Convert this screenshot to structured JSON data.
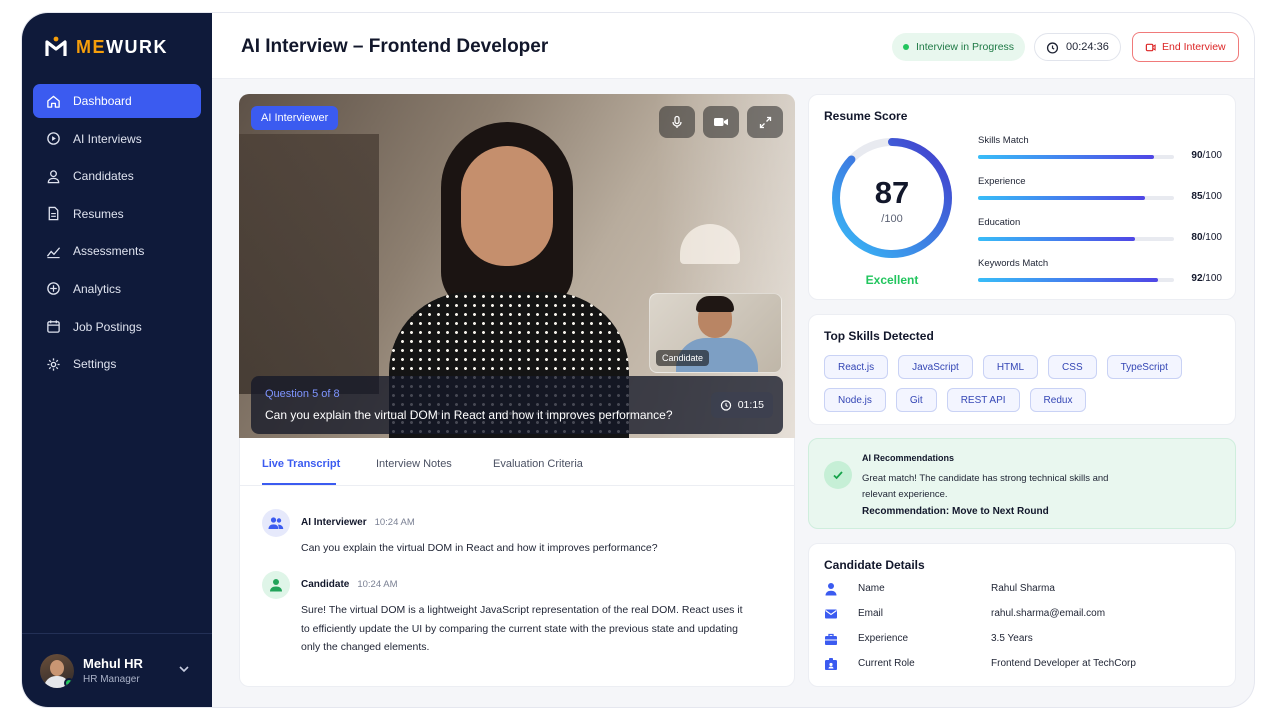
{
  "brand": {
    "name_prefix": "ME",
    "name_suffix": "WURK",
    "accent": "#f59e0b"
  },
  "sidebar": {
    "items": [
      {
        "label": "Dashboard",
        "icon": "home-icon",
        "active": true
      },
      {
        "label": "AI Interviews",
        "icon": "play-circle-icon"
      },
      {
        "label": "Candidates",
        "icon": "user-icon"
      },
      {
        "label": "Resumes",
        "icon": "document-icon"
      },
      {
        "label": "Assessments",
        "icon": "trend-icon"
      },
      {
        "label": "Analytics",
        "icon": "analytics-icon"
      },
      {
        "label": "Job Postings",
        "icon": "calendar-icon"
      },
      {
        "label": "Settings",
        "icon": "gear-icon"
      }
    ],
    "user": {
      "name": "Mehul HR",
      "role": "HR Manager"
    }
  },
  "header": {
    "title": "AI Interview – Frontend Developer",
    "status": "Interview in Progress",
    "timer": "00:24:36",
    "end_label": "End Interview"
  },
  "video": {
    "tag": "AI Interviewer",
    "pip_label": "Candidate",
    "question_number": "Question 5 of 8",
    "question_text": "Can you explain the virtual DOM in React and how it improves performance?",
    "question_timer": "01:15"
  },
  "transcript": {
    "tabs": [
      "Live Transcript",
      "Interview Notes",
      "Evaluation Criteria"
    ],
    "messages": [
      {
        "who": "AI Interviewer",
        "time": "10:24 AM",
        "text": "Can you explain the virtual DOM in React and how it improves performance?"
      },
      {
        "who": "Candidate",
        "time": "10:24 AM",
        "text": "Sure! The virtual DOM is a lightweight JavaScript representation of the real DOM. React uses it to efficiently update the UI by comparing the current state with the previous state and updating only the changed elements."
      }
    ]
  },
  "resume_score": {
    "title": "Resume Score",
    "score": "87",
    "score_value": 87,
    "denominator": "/100",
    "rating": "Excellent",
    "metrics": [
      {
        "label": "Skills Match",
        "value": "90",
        "max": "/100",
        "fraction": 0.9
      },
      {
        "label": "Experience",
        "value": "85",
        "max": "/100",
        "fraction": 0.85
      },
      {
        "label": "Education",
        "value": "80",
        "max": "/100",
        "fraction": 0.8
      },
      {
        "label": "Keywords Match",
        "value": "92",
        "max": "/100",
        "fraction": 0.92
      }
    ]
  },
  "skills": {
    "title": "Top Skills Detected",
    "items": [
      "React.js",
      "JavaScript",
      "HTML",
      "CSS",
      "TypeScript",
      "Node.js",
      "Git",
      "REST API",
      "Redux"
    ]
  },
  "recommendation": {
    "title": "AI Recommendations",
    "text": "Great match! The candidate has strong technical skills and relevant experience.",
    "verdict": "Recommendation: Move to Next Round"
  },
  "details": {
    "title": "Candidate Details",
    "rows": [
      {
        "label": "Name",
        "value": "Rahul Sharma",
        "icon": "person-icon"
      },
      {
        "label": "Email",
        "value": "rahul.sharma@email.com",
        "icon": "mail-icon"
      },
      {
        "label": "Experience",
        "value": "3.5 Years",
        "icon": "briefcase-icon"
      },
      {
        "label": "Current Role",
        "value": "Frontend Developer at TechCorp",
        "icon": "id-badge-icon"
      }
    ]
  },
  "colors": {
    "primary": "#3b5bf0",
    "success": "#22c55e",
    "danger": "#dc2626",
    "sidebar": "#0f1a3a"
  }
}
